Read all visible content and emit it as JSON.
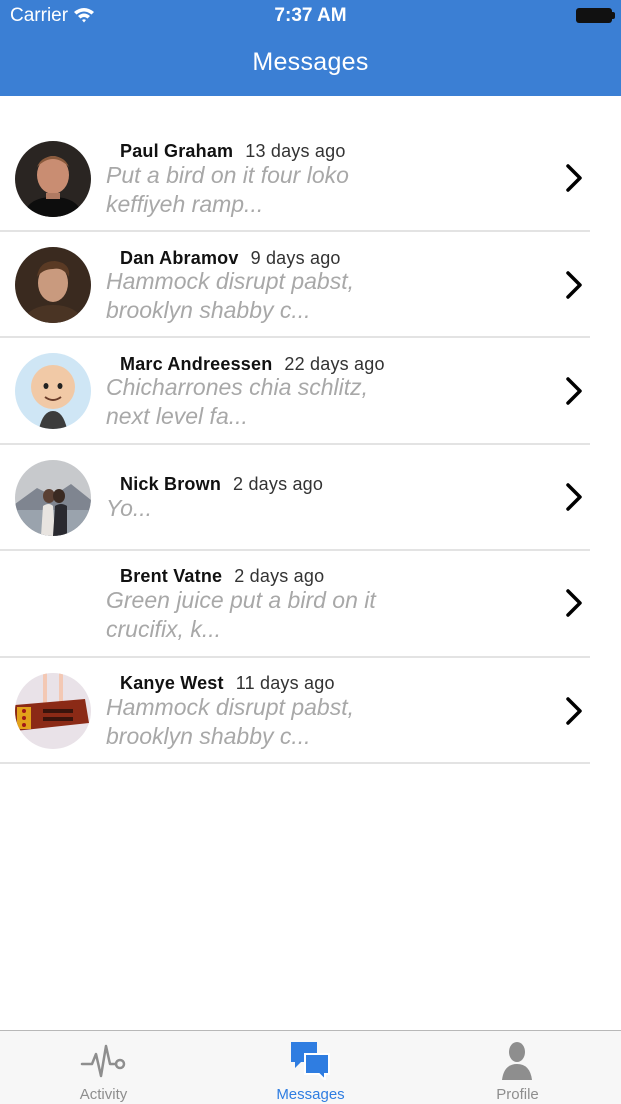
{
  "status_bar": {
    "carrier": "Carrier",
    "time": "7:37 AM"
  },
  "header": {
    "title": "Messages"
  },
  "messages": [
    {
      "name": "Paul Graham",
      "time": "13 days ago",
      "preview_line1": "Put a bird on it four loko",
      "preview_line2": "keffiyeh ramp..."
    },
    {
      "name": "Dan Abramov",
      "time": "9 days ago",
      "preview_line1": "Hammock disrupt pabst,",
      "preview_line2": "brooklyn shabby c..."
    },
    {
      "name": "Marc Andreessen",
      "time": "22 days ago",
      "preview_line1": "Chicharrones chia schlitz,",
      "preview_line2": "next level fa..."
    },
    {
      "name": "Nick Brown",
      "time": "2 days ago",
      "preview_line1": "Yo...",
      "preview_line2": ""
    },
    {
      "name": "Brent Vatne",
      "time": "2 days ago",
      "preview_line1": "Green juice put a bird on it",
      "preview_line2": "crucifix, k..."
    },
    {
      "name": "Kanye West",
      "time": "11 days ago",
      "preview_line1": "Hammock disrupt pabst,",
      "preview_line2": "brooklyn shabby c..."
    }
  ],
  "tabbar": {
    "tabs": [
      {
        "label": "Activity",
        "icon": "activity-pulse-icon"
      },
      {
        "label": "Messages",
        "icon": "chat-bubbles-icon"
      },
      {
        "label": "Profile",
        "icon": "person-icon"
      }
    ],
    "active_index": 1
  },
  "colors": {
    "header": "#3b7fd4",
    "tab_active": "#2f7de1",
    "tab_inactive": "#8e8e8e",
    "preview_text": "#a8a8a8"
  }
}
